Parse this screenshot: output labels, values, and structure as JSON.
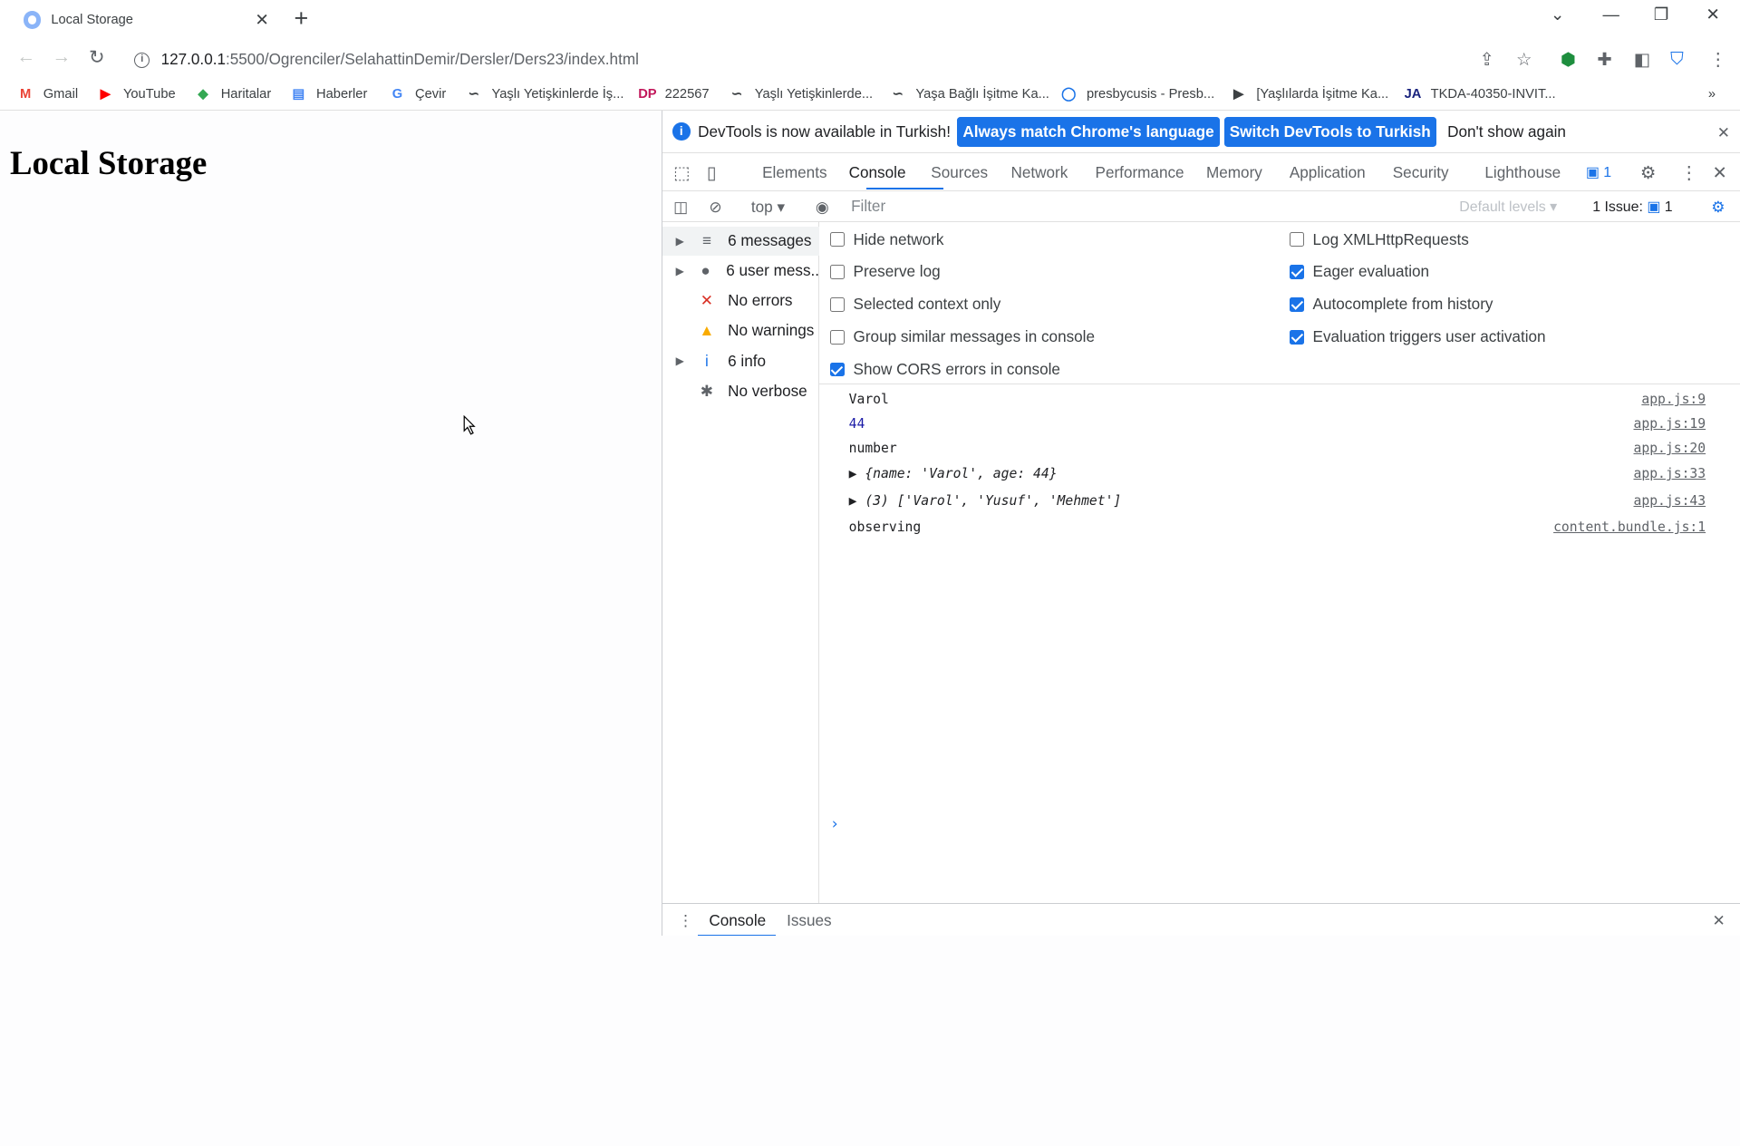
{
  "tab": {
    "title": "Local Storage"
  },
  "address": {
    "host": "127.0.0.1",
    "path": ":5500/Ogrenciler/SelahattinDemir/Dersler/Ders23/index.html"
  },
  "bookmarks": [
    {
      "label": "Gmail",
      "icon": "M",
      "color": "#ea4335"
    },
    {
      "label": "YouTube",
      "icon": "▶",
      "color": "#ff0000"
    },
    {
      "label": "Haritalar",
      "icon": "◆",
      "color": "#34a853"
    },
    {
      "label": "Haberler",
      "icon": "▤",
      "color": "#4285f4"
    },
    {
      "label": "Çevir",
      "icon": "G",
      "color": "#4285f4"
    },
    {
      "label": "Yaşlı Yetişkinlerde İş...",
      "icon": "∽",
      "color": "#3c4043"
    },
    {
      "label": "222567",
      "icon": "DP",
      "color": "#c2185b"
    },
    {
      "label": "Yaşlı Yetişkinlerde...",
      "icon": "∽",
      "color": "#3c4043"
    },
    {
      "label": "Yaşa Bağlı İşitme Ka...",
      "icon": "∽",
      "color": "#3c4043"
    },
    {
      "label": "presbycusis - Presb...",
      "icon": "◯",
      "color": "#1a73e8"
    },
    {
      "label": "[Yaşlılarda İşitme Ka...",
      "icon": "▶",
      "color": "#3c4043"
    },
    {
      "label": "TKDA-40350-INVIT...",
      "icon": "JA",
      "color": "#1a237e"
    }
  ],
  "page": {
    "heading": "Local Storage"
  },
  "devtools": {
    "infobar": {
      "message": "DevTools is now available in Turkish!",
      "btn_match": "Always match Chrome's language",
      "btn_switch": "Switch DevTools to Turkish",
      "dont_show": "Don't show again"
    },
    "tabs": [
      "Elements",
      "Console",
      "Sources",
      "Network",
      "Performance",
      "Memory",
      "Application",
      "Security",
      "Lighthouse"
    ],
    "issues_badge": "1",
    "filterbar": {
      "context": "top",
      "filter_placeholder": "Filter",
      "levels": "Default levels",
      "issues_label": "1 Issue:",
      "issues_count": "1"
    },
    "sidebar": [
      {
        "label": "6 messages",
        "icon": "≡"
      },
      {
        "label": "6 user mess...",
        "icon": "●"
      },
      {
        "label": "No errors",
        "icon": "✕"
      },
      {
        "label": "No warnings",
        "icon": "▲"
      },
      {
        "label": "6 info",
        "icon": "i"
      },
      {
        "label": "No verbose",
        "icon": "✱"
      }
    ],
    "settings": {
      "left": [
        {
          "label": "Hide network",
          "checked": false
        },
        {
          "label": "Preserve log",
          "checked": false
        },
        {
          "label": "Selected context only",
          "checked": false
        },
        {
          "label": "Group similar messages in console",
          "checked": false
        },
        {
          "label": "Show CORS errors in console",
          "checked": true
        }
      ],
      "right": [
        {
          "label": "Log XMLHttpRequests",
          "checked": false
        },
        {
          "label": "Eager evaluation",
          "checked": true
        },
        {
          "label": "Autocomplete from history",
          "checked": true
        },
        {
          "label": "Evaluation triggers user activation",
          "checked": true
        }
      ]
    },
    "console": {
      "lines": [
        {
          "text": "Varol",
          "source": "app.js:9"
        },
        {
          "text": "44",
          "source": "app.js:19"
        },
        {
          "text": "number",
          "source": "app.js:20"
        },
        {
          "text": "▶ {name: 'Varol', age: 44}",
          "source": "app.js:33"
        },
        {
          "text": "▶ (3) ['Varol', 'Yusuf', 'Mehmet']",
          "source": "app.js:43"
        },
        {
          "text": "observing",
          "source": "content.bundle.js:1"
        }
      ],
      "prompt": "›"
    },
    "drawer": {
      "tabs": [
        "Console",
        "Issues"
      ]
    }
  }
}
